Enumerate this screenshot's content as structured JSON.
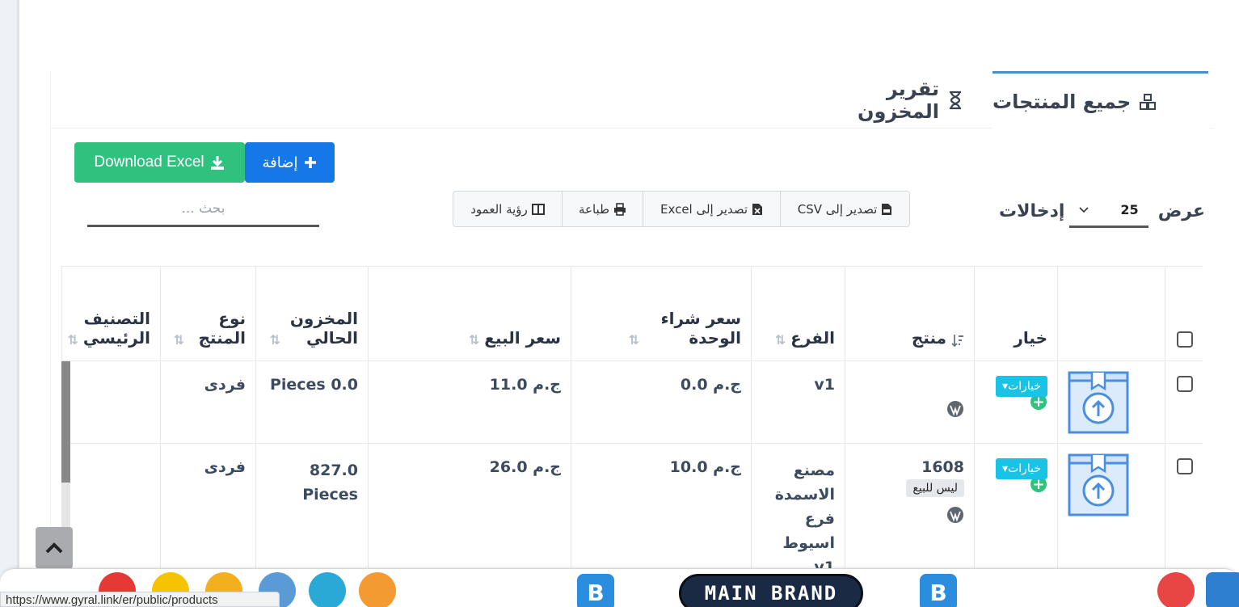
{
  "tabs": {
    "all_products": "جميع المنتجات",
    "stock_report": "تقرير المخزون"
  },
  "toolbar": {
    "download_excel": "Download Excel",
    "add": "إضافة",
    "search_placeholder": "بحث ..."
  },
  "export_buttons": {
    "csv": "تصدير إلى CSV",
    "excel": "تصدير إلى Excel",
    "print": "طباعة",
    "column_visibility": "رؤية العمود"
  },
  "entries": {
    "show": "عرض",
    "value": "25",
    "entries": "إدخالات"
  },
  "table": {
    "columns": [
      "",
      "",
      "خيار",
      "منتج",
      "الفرع",
      "سعر شراء الوحدة",
      "سعر البيع",
      "المخزون الحالي",
      "نوع المنتج",
      "التصنيف الرئيسي"
    ],
    "rows": [
      {
        "options": "خيارات",
        "product": "",
        "badge": "",
        "branch": "v1",
        "unit_price": "ج.م 0.0",
        "sell_price": "ج.م 11.0",
        "stock": "Pieces 0.0",
        "type": "فردى"
      },
      {
        "options": "خيارات",
        "product": "1608",
        "badge": "ليس للبيع",
        "branch": "مصنع الاسمدة فرع اسيوط v1",
        "unit_price": "ج.م 10.0",
        "sell_price": "ج.م 26.0",
        "stock": "827.0 Pieces",
        "type": "فردى"
      }
    ]
  },
  "dock": {
    "brand": "MAIN BRAND",
    "b_label": "B",
    "url": "https://www.gyral.link/er/public/products"
  },
  "colors": {
    "accent": "#1677e8",
    "success": "#2ec27e",
    "info": "#19c3e6",
    "tab_border": "#4a90c8"
  }
}
